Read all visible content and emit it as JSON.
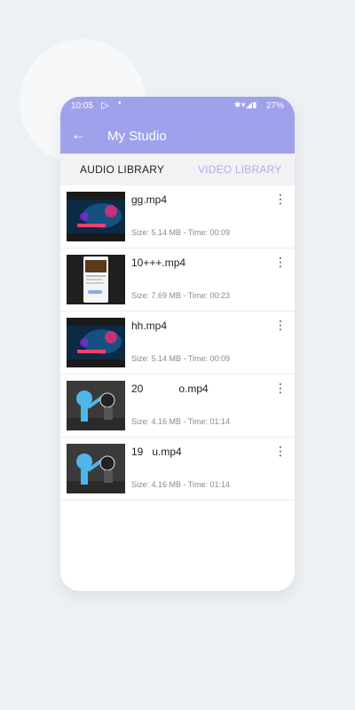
{
  "status_bar": {
    "time": "10:05",
    "battery": "27%"
  },
  "header": {
    "title": "My Studio",
    "color": "#9fa2ea"
  },
  "tabs": [
    {
      "label": "AUDIO LIBRARY",
      "active": true
    },
    {
      "label": "VIDEO LIBRARY",
      "active": false
    }
  ],
  "items": [
    {
      "name": "gg.mp4",
      "meta": "Size: 5.14 MB - Time: 00:09",
      "thumb": "neon-scene"
    },
    {
      "name": "10+++.mp4",
      "meta": "Size: 7.69 MB - Time: 00:23",
      "thumb": "phone-screen"
    },
    {
      "name": "hh.mp4",
      "meta": "Size: 5.14 MB - Time: 00:09",
      "thumb": "neon-scene"
    },
    {
      "name": "20            o.mp4",
      "meta": "Size: 4.16 MB - Time: 01:14",
      "thumb": "cartoon"
    },
    {
      "name": "19   u.mp4",
      "meta": "Size: 4.16 MB - Time: 01:14",
      "thumb": "cartoon"
    }
  ]
}
